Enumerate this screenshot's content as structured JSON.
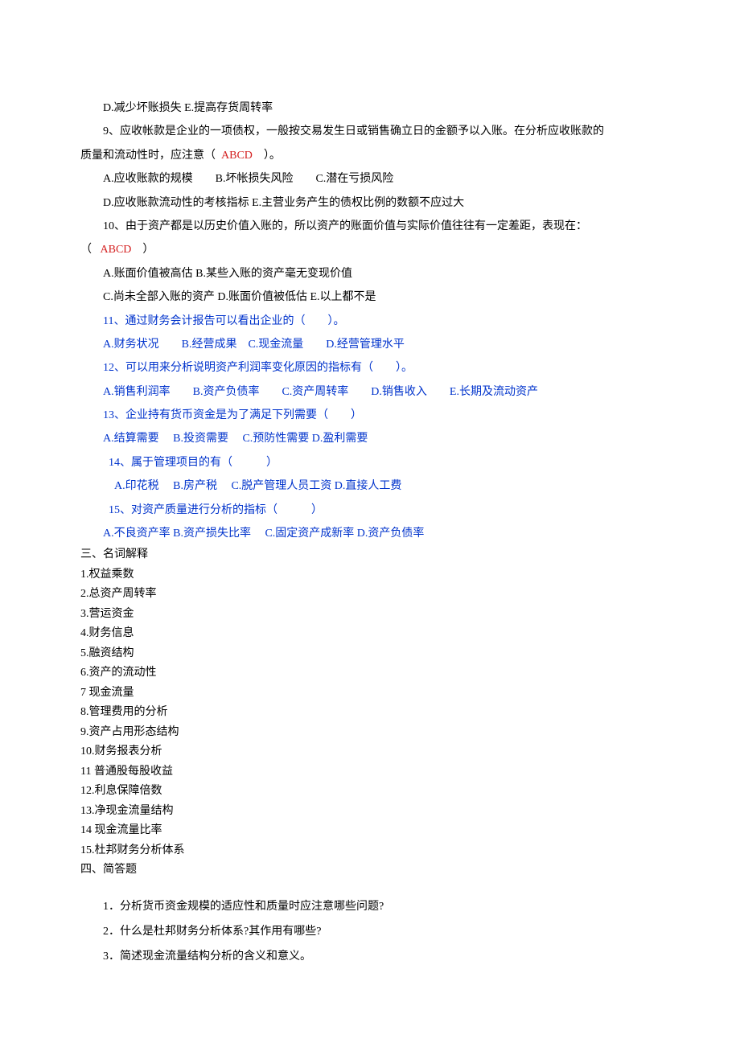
{
  "q8": {
    "options_de": "D.减少坏账损失  E.提高存货周转率"
  },
  "q9": {
    "stem_a": "9、应收帐款是企业的一项债权，一般按交易发生日或销售确立日的金额予以入账。在分析应收账款的",
    "stem_b_pre": "质量和流动性时，应注意（",
    "answer": "ABCD",
    "stem_b_post": "）。",
    "options_abc": "A.应收账款的规模　　B.坏帐损失风险　　C.潜在亏损风险",
    "options_de": "D.应收账款流动性的考核指标  E.主营业务产生的债权比例的数额不应过大"
  },
  "q10": {
    "stem": "10、由于资产都是以历史价值入账的，所以资产的账面价值与实际价值往往有一定差距，表现在：",
    "paren_open": "（",
    "answer": "ABCD",
    "paren_close": "）",
    "options_ab": "A.账面价值被高估  B.某些入账的资产毫无变现价值",
    "options_cde": "C.尚未全部入账的资产  D.账面价值被低估  E.以上都不是"
  },
  "q11": {
    "stem": "11、通过财务会计报告可以看出企业的（　　）。",
    "options": "A.财务状况　　B.经营成果　C.现金流量　　D.经营管理水平"
  },
  "q12": {
    "stem": "12、可以用来分析说明资产利润率变化原因的指标有（　　）。",
    "options": "A.销售利润率　　B.资产负债率　　C.资产周转率　　D.销售收入　　E.长期及流动资产"
  },
  "q13": {
    "stem": "13、企业持有货币资金是为了满足下列需要（　　）",
    "options": "A.结算需要　  B.投资需要　 C.预防性需要  D.盈利需要"
  },
  "q14": {
    "stem": "14、属于管理项目的有（　　　）",
    "options": "　A.印花税　  B.房产税　 C.脱产管理人员工资 D.直接人工费"
  },
  "q15": {
    "stem": "15、对资产质量进行分析的指标（　　　）",
    "options": "A.不良资产率 B.资产损失比率　 C.固定资产成新率  D.资产负债率"
  },
  "section3": {
    "title": "三、名词解释",
    "items": {
      "1": "1.权益乘数",
      "2": "2.总资产周转率",
      "3": "3.营运资金",
      "4": "4.财务信息",
      "5": "5.融资结构",
      "6": "6.资产的流动性",
      "7": "7 现金流量",
      "8": "8.管理费用的分析",
      "9": "9.资产占用形态结构",
      "10": "10.财务报表分析",
      "11": "11 普通股每股收益",
      "12": "12.利息保障倍数",
      "13": "13.净现金流量结构",
      "14": "14 现金流量比率",
      "15": "15.杜邦财务分析体系"
    }
  },
  "section4": {
    "title": "四、简答题",
    "q1": "1．分析货币资金规模的适应性和质量时应注意哪些问题?",
    "q2": "2．什么是杜邦财务分析体系?其作用有哪些?",
    "q3": "3．简述现金流量结构分析的含义和意义。"
  }
}
